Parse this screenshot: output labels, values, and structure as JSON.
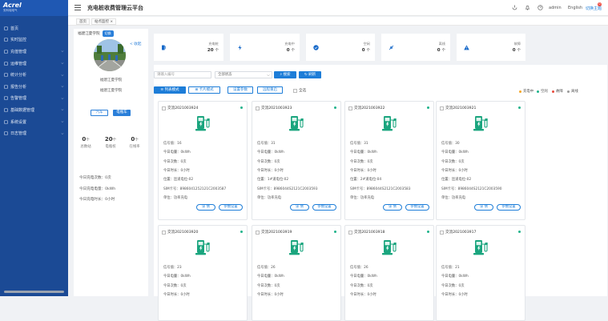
{
  "app": {
    "logo": "Acrel",
    "logo_sub": "安科瑞电气",
    "title": "充电桩收费管理云平台"
  },
  "topbar": {
    "user": "admin",
    "lang": "English",
    "toggle": "切换主题",
    "badge": "0"
  },
  "tabs": [
    {
      "label": "首页"
    },
    {
      "label": "站点监控 ×"
    }
  ],
  "sidebar": {
    "items": [
      {
        "label": "首页",
        "icon": "home-icon",
        "arrow": false
      },
      {
        "label": "实时监控",
        "icon": "monitor-icon",
        "arrow": false
      },
      {
        "label": "充值管理",
        "icon": "recharge-icon",
        "arrow": true
      },
      {
        "label": "运维管理",
        "icon": "wrench-icon",
        "arrow": true
      },
      {
        "label": "统计分析",
        "icon": "bar-chart-icon",
        "arrow": true
      },
      {
        "label": "报告分析",
        "icon": "report-icon",
        "arrow": true
      },
      {
        "label": "告警管理",
        "icon": "bell-icon",
        "arrow": true
      },
      {
        "label": "基础数据管理",
        "icon": "database-icon",
        "arrow": true
      },
      {
        "label": "系统设置",
        "icon": "gear-icon",
        "arrow": true
      },
      {
        "label": "日志管理",
        "icon": "log-icon",
        "arrow": true
      }
    ]
  },
  "station": {
    "name_head": "福建江夏学院",
    "switch": "切换",
    "collapse": "< 收起",
    "name": "福建江夏学院",
    "address": "福建江夏学院",
    "mode_car": "汽车",
    "mode_bike": "电瓶车",
    "summary": [
      {
        "value": "0",
        "unit": "个",
        "label": "总数站"
      },
      {
        "value": "20",
        "unit": "个",
        "label": "电瓶桩"
      },
      {
        "value": "0",
        "unit": "个",
        "label": "在线率"
      }
    ],
    "today": [
      "今日充电次数：0次",
      "今日充电电量：0kWh",
      "今日充电时长：0小时"
    ]
  },
  "stats": [
    {
      "label": "充电桩",
      "value": "20",
      "unit": "个",
      "icon": "charger-icon"
    },
    {
      "label": "充电中",
      "value": "0",
      "unit": "个",
      "icon": "lightning-icon"
    },
    {
      "label": "空闲",
      "value": "0",
      "unit": "个",
      "icon": "check-circle-icon"
    },
    {
      "label": "离线",
      "value": "0",
      "unit": "个",
      "icon": "unplug-icon"
    },
    {
      "label": "故障",
      "value": "0",
      "unit": "个",
      "icon": "warning-icon"
    }
  ],
  "filter": {
    "placeholder": "请输入编号",
    "status": "全部状态",
    "search": "搜索",
    "refresh": "刷新"
  },
  "views": {
    "list": "列表模式",
    "card": "卡片模式",
    "settings": "设置参数",
    "remote": "远程重启"
  },
  "select_all": "全选",
  "legend": [
    {
      "label": "充电中",
      "color": "#f5a623"
    },
    {
      "label": "空闲",
      "color": "#1fb38b"
    },
    {
      "label": "故障",
      "color": "#e84a3c"
    },
    {
      "label": "离线",
      "color": "#9a9a9a"
    }
  ],
  "card_buttons": {
    "detail": "详 情",
    "params": "参数设置"
  },
  "cards": [
    {
      "id": "交流2021003924",
      "lines": [
        "信号值：16",
        "今日电量：0kWh",
        "今日次数：0次",
        "今日时长：0小时",
        "位置：匝道电位-02",
        "SIM卡号：8986041252121C2003587",
        "单位：功率充电"
      ]
    },
    {
      "id": "交流2021003923",
      "lines": [
        "信号值：31",
        "今日电量：0kWh",
        "今日次数：0次",
        "今日时长：0小时",
        "位置：1#道电位-02",
        "SIM卡号：8986044S2121C2003593",
        "单位：功率充电"
      ]
    },
    {
      "id": "交流2021003922",
      "lines": [
        "信号值：31",
        "今日电量：0kWh",
        "今日次数：0次",
        "今日时长：0小时",
        "位置：2#道电位-04",
        "SIM卡号：8986044S2121C2003583",
        "单位：功率充电"
      ]
    },
    {
      "id": "交流2021003921",
      "lines": [
        "信号值：30",
        "今日电量：0kWh",
        "今日次数：0次",
        "今日时长：0小时",
        "位置：匝道电位-02",
        "SIM卡号：8986044S2121C2003590",
        "单位：功率充电"
      ]
    },
    {
      "id": "交流2021003920",
      "lines": [
        "信号值：23",
        "今日电量：0kWh",
        "今日次数：0次",
        "今日时长：0小时"
      ]
    },
    {
      "id": "交流2021003919",
      "lines": [
        "信号值：26",
        "今日电量：0kWh",
        "今日次数：0次",
        "今日时长：0小时"
      ]
    },
    {
      "id": "交流2021003918",
      "lines": [
        "信号值：26",
        "今日电量：0kWh",
        "今日次数：0次",
        "今日时长：0小时"
      ]
    },
    {
      "id": "交流2021003917",
      "lines": [
        "信号值：21",
        "今日电量：0kWh",
        "今日次数：0次",
        "今日时长：0小时"
      ]
    }
  ]
}
